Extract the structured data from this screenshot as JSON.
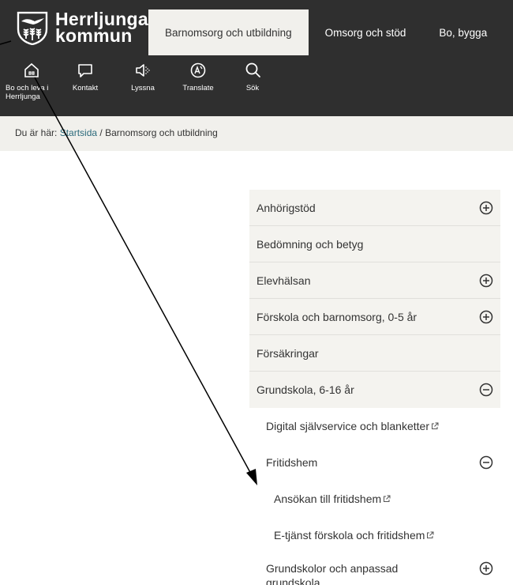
{
  "header": {
    "logo": {
      "line1": "Herrljunga",
      "line2": "kommun"
    },
    "nav": [
      {
        "label": "Barnomsorg och utbildning",
        "active": true
      },
      {
        "label": "Omsorg och stöd",
        "active": false
      },
      {
        "label": "Bo, bygga",
        "active": false
      }
    ],
    "tools": [
      {
        "icon": "home-icon",
        "label": "Bo och leva i Herrljunga"
      },
      {
        "icon": "chat-icon",
        "label": "Kontakt"
      },
      {
        "icon": "speaker-icon",
        "label": "Lyssna"
      },
      {
        "icon": "translate-icon",
        "label": "Translate"
      },
      {
        "icon": "search-icon",
        "label": "Sök"
      }
    ],
    "colors": {
      "background": "#2f2f2f",
      "active_tab": "#f1f0ec"
    }
  },
  "breadcrumb": {
    "prefix": "Du är här:",
    "home": "Startsida",
    "separator": "/",
    "current": "Barnomsorg och utbildning"
  },
  "menu": {
    "items": [
      {
        "label": "Anhörigstöd",
        "toggle": "plus"
      },
      {
        "label": "Bedömning och betyg",
        "toggle": ""
      },
      {
        "label": "Elevhälsan",
        "toggle": "plus"
      },
      {
        "label": "Förskola och barnomsorg, 0-5 år",
        "toggle": "plus"
      },
      {
        "label": "Försäkringar",
        "toggle": ""
      },
      {
        "label": "Grundskola, 6-16 år",
        "toggle": "minus"
      },
      {
        "label": "Digital självservice och blanketter",
        "toggle": "",
        "external": true
      },
      {
        "label": "Fritidshem",
        "toggle": "minus"
      },
      {
        "label": "Ansökan till fritidshem",
        "toggle": "",
        "external": true
      },
      {
        "label": "E-tjänst förskola och fritidshem",
        "toggle": "",
        "external": true
      },
      {
        "label": "Grundskolor och anpassad grundskola",
        "toggle": "plus"
      }
    ],
    "colors": {
      "row_bg": "#f4f3ef",
      "divider": "#e0dfdb"
    }
  }
}
